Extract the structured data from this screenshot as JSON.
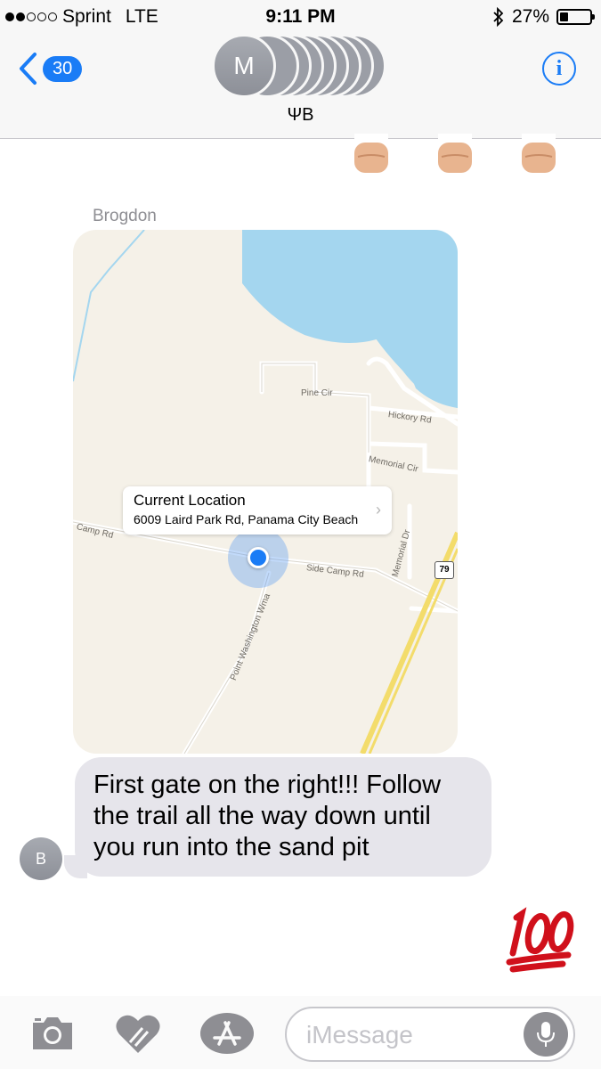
{
  "status_bar": {
    "carrier": "Sprint",
    "network": "LTE",
    "time": "9:11 PM",
    "battery": "27%",
    "battery_level": 0.27
  },
  "header": {
    "back_count": "30",
    "front_avatar_initial": "M",
    "group_name": "ΨΒ",
    "info_label": "i"
  },
  "thread": {
    "tapbacks": [
      "fist",
      "fist",
      "fist"
    ],
    "sender_name": "Brogdon",
    "location": {
      "title": "Current Location",
      "address": "6009 Laird Park Rd, Panama City Beach",
      "roads": [
        "Pine Cir",
        "Hickory Rd",
        "Memorial Cir",
        "Camp Rd",
        "Side Camp Rd",
        "Memorial Dr",
        "Point Washington Wma"
      ],
      "route_shield": "79"
    },
    "message_lines": [
      "First gate on the right!!! Follow",
      "the trail all the way down until",
      "you run into the sand pit"
    ],
    "sender_initial": "B",
    "reaction_emoji": "100"
  },
  "compose": {
    "placeholder": "iMessage",
    "icons": [
      "camera-icon",
      "digital-touch-icon",
      "app-store-icon",
      "microphone-icon"
    ]
  },
  "colors": {
    "accent": "#1a7cf6",
    "bubble": "#e6e5eb",
    "water": "#a4d6ef",
    "land": "#f5f1e8"
  }
}
